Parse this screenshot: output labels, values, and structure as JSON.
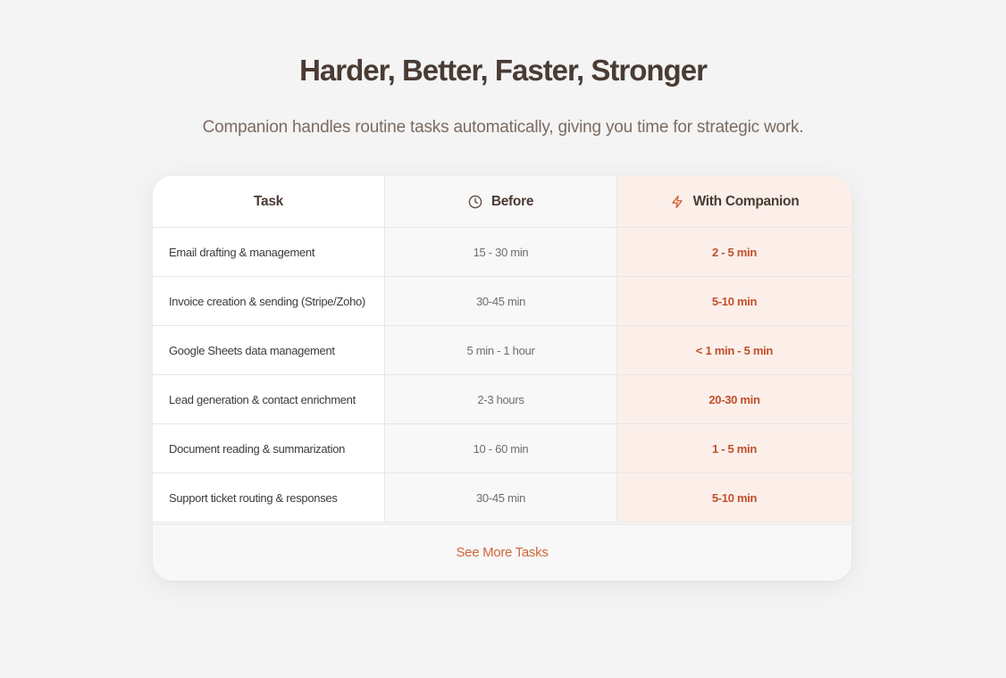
{
  "header": {
    "title": "Harder, Better, Faster, Stronger",
    "subtitle": "Companion handles routine tasks automatically, giving you time for strategic work."
  },
  "table": {
    "columns": {
      "task": "Task",
      "before": "Before",
      "with": "With Companion"
    },
    "column_icons": {
      "before": "clock-icon",
      "with": "lightning-icon"
    },
    "rows": [
      {
        "task": "Email drafting & management",
        "before": "15 - 30 min",
        "with": "2 - 5 min"
      },
      {
        "task": "Invoice creation & sending (Stripe/Zoho)",
        "before": "30-45 min",
        "with": "5-10 min"
      },
      {
        "task": "Google Sheets data management",
        "before": "5 min - 1 hour",
        "with": "< 1 min - 5 min"
      },
      {
        "task": "Lead generation & contact enrichment",
        "before": "2-3 hours",
        "with": "20-30 min"
      },
      {
        "task": "Document reading & summarization",
        "before": "10 - 60 min",
        "with": "1 - 5 min"
      },
      {
        "task": "Support ticket routing & responses",
        "before": "30-45 min",
        "with": "5-10 min"
      }
    ],
    "footer_link": "See More Tasks"
  },
  "colors": {
    "background": "#f4f4f4",
    "heading": "#4a3b34",
    "subtitle": "#7b6b62",
    "accent": "#c0502a",
    "link": "#d0653a",
    "companion_column_bg": "#fcefea",
    "before_column_bg": "#f8f8f8"
  }
}
